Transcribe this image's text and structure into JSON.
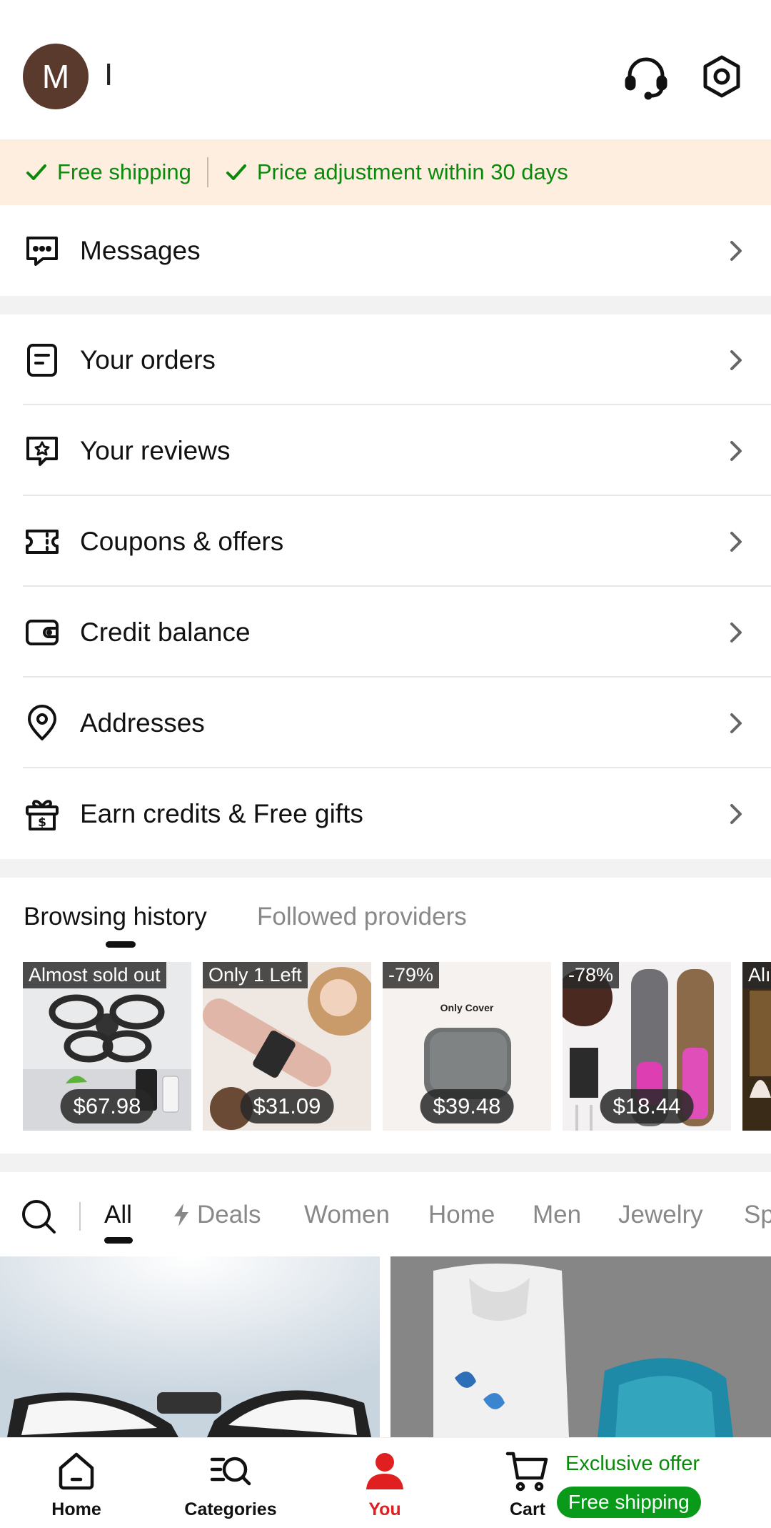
{
  "header": {
    "avatar_letter": "M",
    "username": "I"
  },
  "banner": {
    "benefit_1": "Free shipping",
    "benefit_2": "Price adjustment within 30 days"
  },
  "menu": {
    "messages": "Messages",
    "orders": "Your orders",
    "reviews": "Your reviews",
    "coupons": "Coupons & offers",
    "credit": "Credit balance",
    "addresses": "Addresses",
    "earn": "Earn credits & Free gifts"
  },
  "browsing": {
    "tab_history": "Browsing history",
    "tab_followed": "Followed providers",
    "items": [
      {
        "badge": "Almost sold out",
        "price": "$67.98"
      },
      {
        "badge": "Only 1 Left",
        "price": "$31.09"
      },
      {
        "badge": "-79%",
        "price": "$39.48",
        "caption": "Only Cover"
      },
      {
        "badge": "-78%",
        "price": "$18.44"
      },
      {
        "badge": "Alı",
        "price": ""
      }
    ]
  },
  "categories": {
    "all": "All",
    "deals": "Deals",
    "women": "Women",
    "home": "Home",
    "men": "Men",
    "jewelry": "Jewelry",
    "more": "Sp"
  },
  "bottom_nav": {
    "home": "Home",
    "categories": "Categories",
    "you": "You",
    "cart": "Cart",
    "offer_title": "Exclusive offer",
    "offer_pill": "Free shipping"
  },
  "colors": {
    "accent_green": "#0a8a0a",
    "active_red": "#e02020",
    "banner_bg": "#fdeee0"
  }
}
